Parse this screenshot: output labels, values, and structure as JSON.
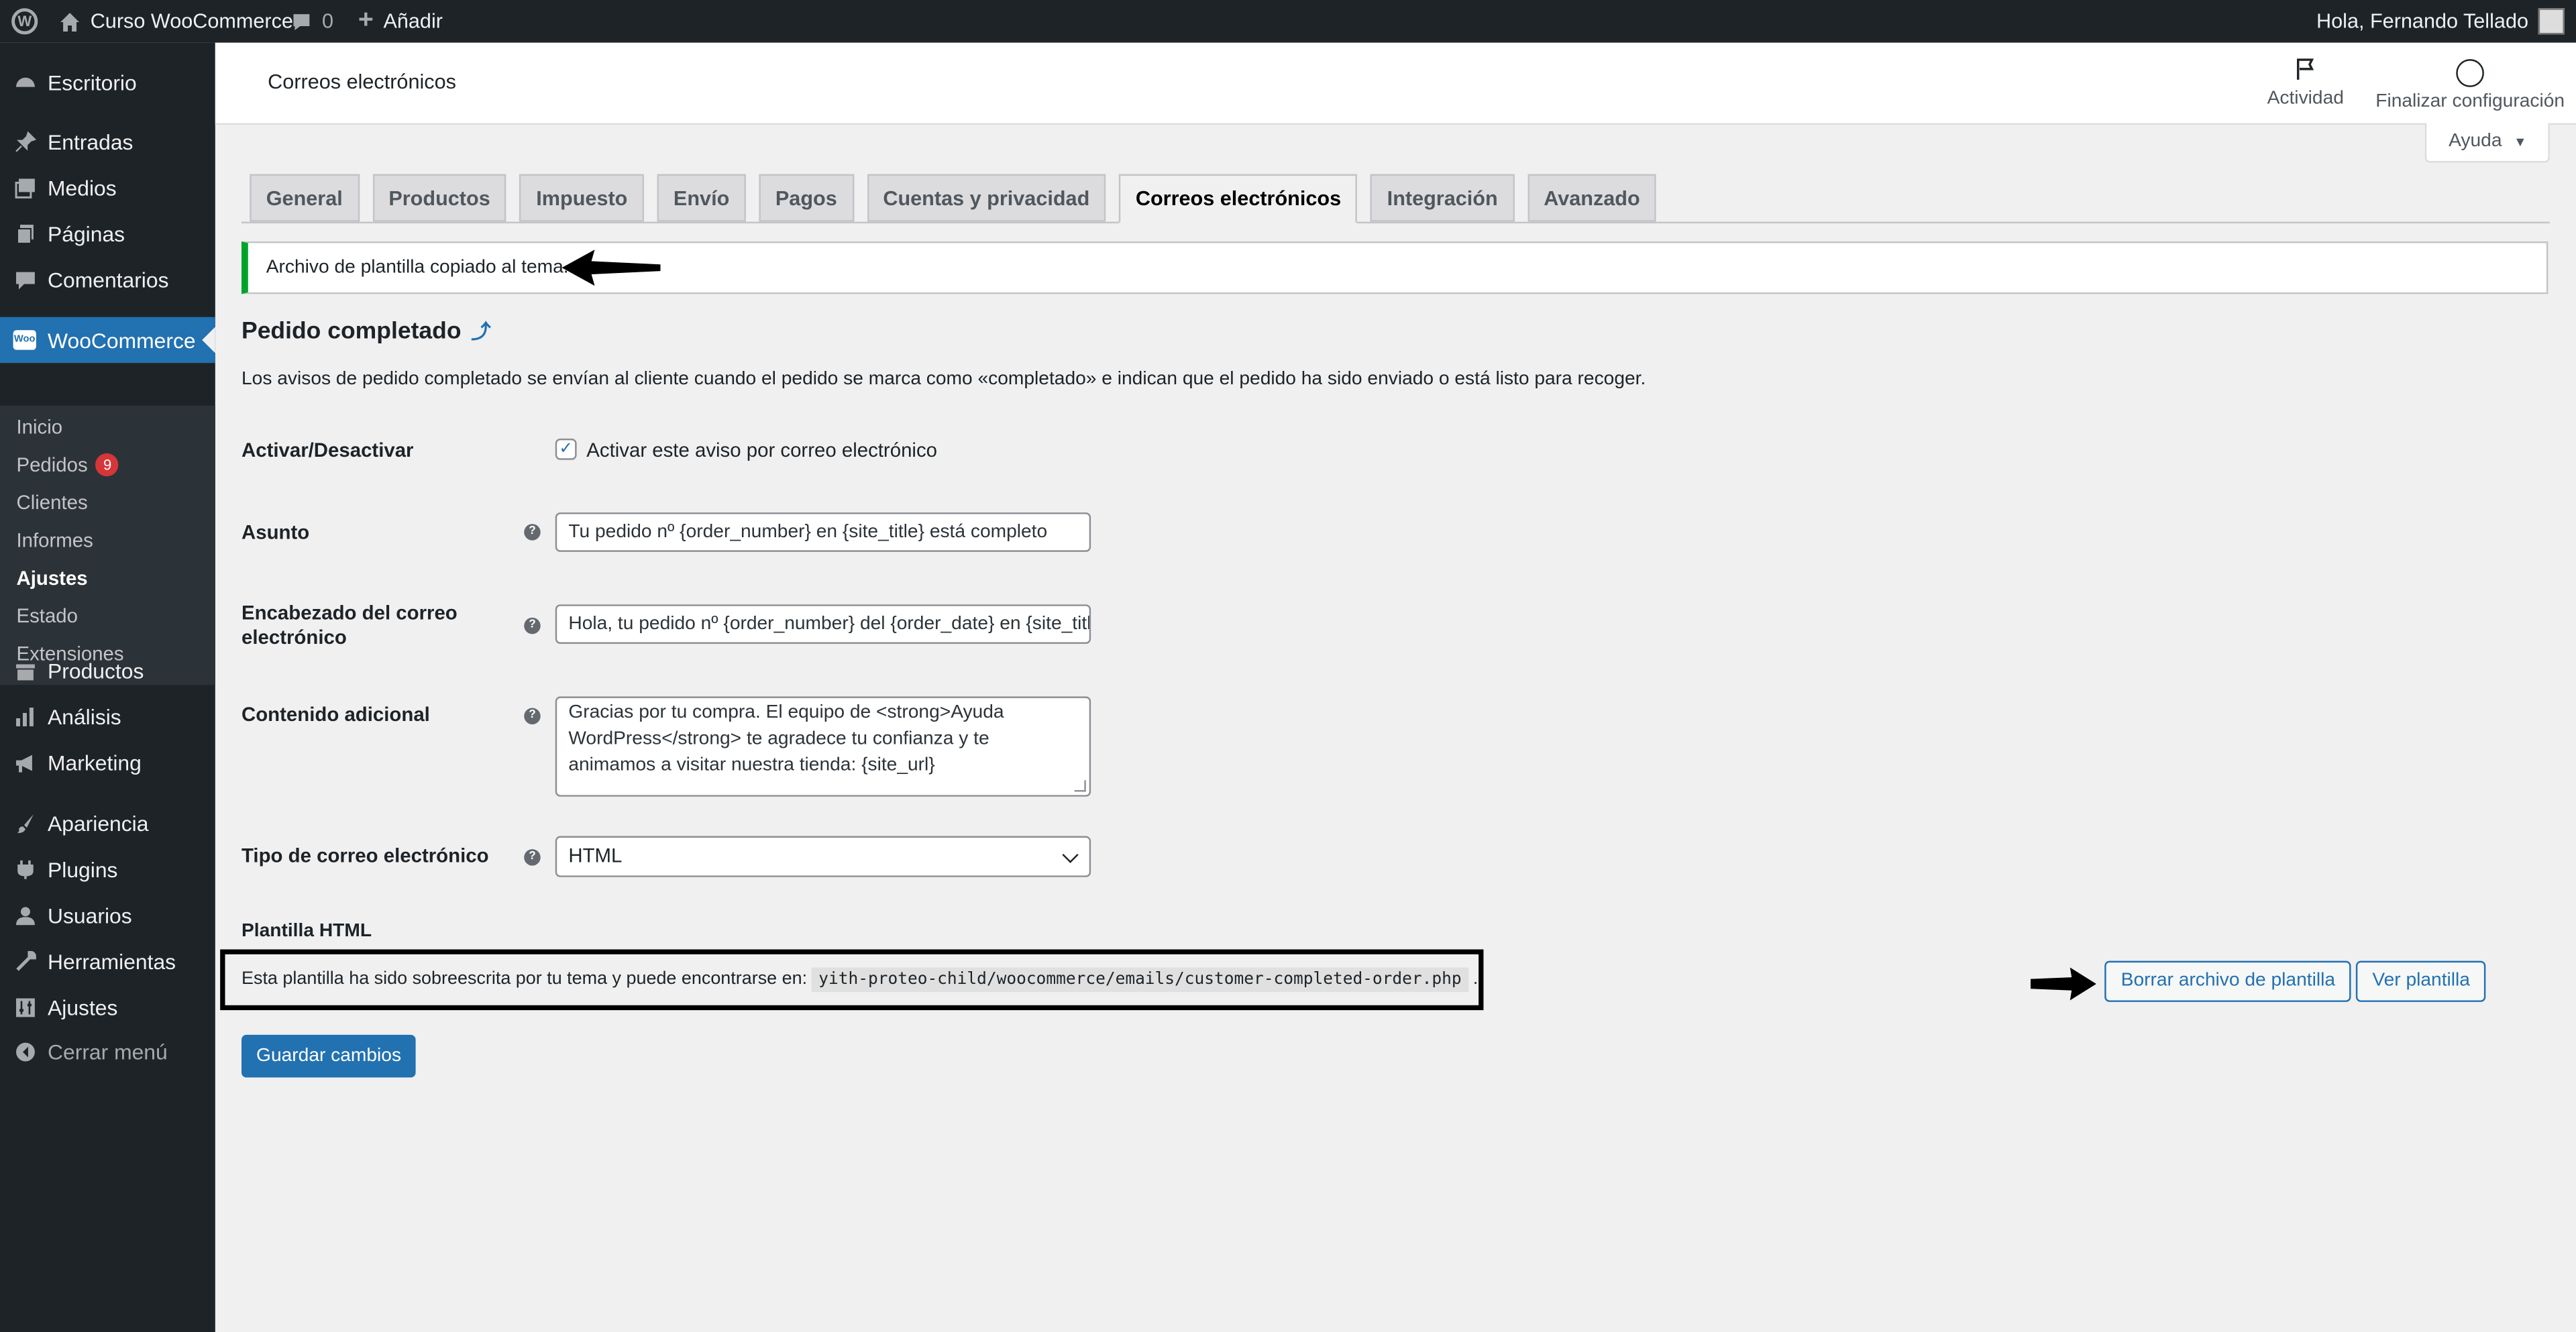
{
  "adminbar": {
    "site_name": "Curso WooCommerce",
    "comments_count": "0",
    "add_label": "Añadir",
    "greeting": "Hola, Fernando Tellado"
  },
  "sidebar": {
    "items": [
      {
        "label": "Escritorio",
        "icon": "dashboard-icon"
      },
      {
        "label": "Entradas",
        "icon": "pin-icon"
      },
      {
        "label": "Medios",
        "icon": "media-icon"
      },
      {
        "label": "Páginas",
        "icon": "pages-icon"
      },
      {
        "label": "Comentarios",
        "icon": "comments-icon"
      },
      {
        "label": "WooCommerce",
        "icon": "woocommerce-icon"
      },
      {
        "label": "Productos",
        "icon": "products-icon"
      },
      {
        "label": "Análisis",
        "icon": "analytics-icon"
      },
      {
        "label": "Marketing",
        "icon": "marketing-icon"
      },
      {
        "label": "Apariencia",
        "icon": "appearance-icon"
      },
      {
        "label": "Plugins",
        "icon": "plugins-icon"
      },
      {
        "label": "Usuarios",
        "icon": "users-icon"
      },
      {
        "label": "Herramientas",
        "icon": "tools-icon"
      },
      {
        "label": "Ajustes",
        "icon": "settings-icon"
      },
      {
        "label": "Cerrar menú",
        "icon": "collapse-icon"
      }
    ],
    "submenu": [
      {
        "label": "Inicio"
      },
      {
        "label": "Pedidos",
        "badge": "9"
      },
      {
        "label": "Clientes"
      },
      {
        "label": "Informes"
      },
      {
        "label": "Ajustes"
      },
      {
        "label": "Estado"
      },
      {
        "label": "Extensiones"
      }
    ]
  },
  "header": {
    "title": "Correos electrónicos",
    "activity_label": "Actividad",
    "finish_label": "Finalizar configuración",
    "help_label": "Ayuda"
  },
  "tabs": [
    "General",
    "Productos",
    "Impuesto",
    "Envío",
    "Pagos",
    "Cuentas y privacidad",
    "Correos electrónicos",
    "Integración",
    "Avanzado"
  ],
  "notice": "Archivo de plantilla copiado al tema.",
  "section": {
    "title": "Pedido completado",
    "up_link": "⤴",
    "description": "Los avisos de pedido completado se envían al cliente cuando el pedido se marca como «completado» e indican que el pedido ha sido enviado o está listo para recoger."
  },
  "form": {
    "enable_label": "Activar/Desactivar",
    "enable_checkbox_label": "Activar este aviso por correo electrónico",
    "subject_label": "Asunto",
    "subject_value": "Tu pedido nº {order_number} en {site_title} está completo",
    "heading_label": "Encabezado del correo electrónico",
    "heading_value": "Hola, tu pedido nº {order_number} del {order_date} en {site_title} está completo",
    "additional_label": "Contenido adicional",
    "additional_value": "Gracias por tu compra. El equipo de <strong>Ayuda WordPress</strong> te agradece tu confianza y te animamos a visitar nuestra tienda: {site_url}",
    "type_label": "Tipo de correo electrónico",
    "type_value": "HTML"
  },
  "template": {
    "title": "Plantilla HTML",
    "text": "Esta plantilla ha sido sobreescrita por tu tema y puede encontrarse en:",
    "path": "yith-proteo-child/woocommerce/emails/customer-completed-order.php",
    "period": ".",
    "delete_button": "Borrar archivo de plantilla",
    "view_button": "Ver plantilla"
  },
  "save_button": "Guardar cambios"
}
